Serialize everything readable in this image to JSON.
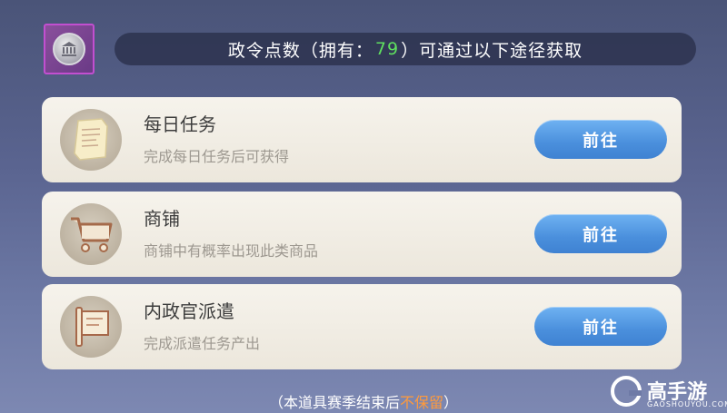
{
  "header": {
    "prefix": "政令点数（拥有：",
    "count": "79",
    "suffix": "）可通过以下途径获取",
    "icon": "politics-coin-icon"
  },
  "cards": [
    {
      "title": "每日任务",
      "desc": "完成每日任务后可获得",
      "button": "前往",
      "icon": "scroll-icon"
    },
    {
      "title": "商铺",
      "desc": "商铺中有概率出现此类商品",
      "button": "前往",
      "icon": "cart-icon"
    },
    {
      "title": "内政官派遣",
      "desc": "完成派遣任务产出",
      "button": "前往",
      "icon": "dispatch-flag-icon"
    }
  ],
  "footer": {
    "note_prefix": "（本道具赛季结束后",
    "note_warn": "不保留",
    "note_suffix": "）"
  },
  "watermark": {
    "name": "高手游",
    "domain": "GAOSHOUYOU.COM"
  },
  "colors": {
    "count": "#5fe05f",
    "warn": "#ff9a3c",
    "button": "#4a8fdc",
    "card": "#f2eee6"
  }
}
